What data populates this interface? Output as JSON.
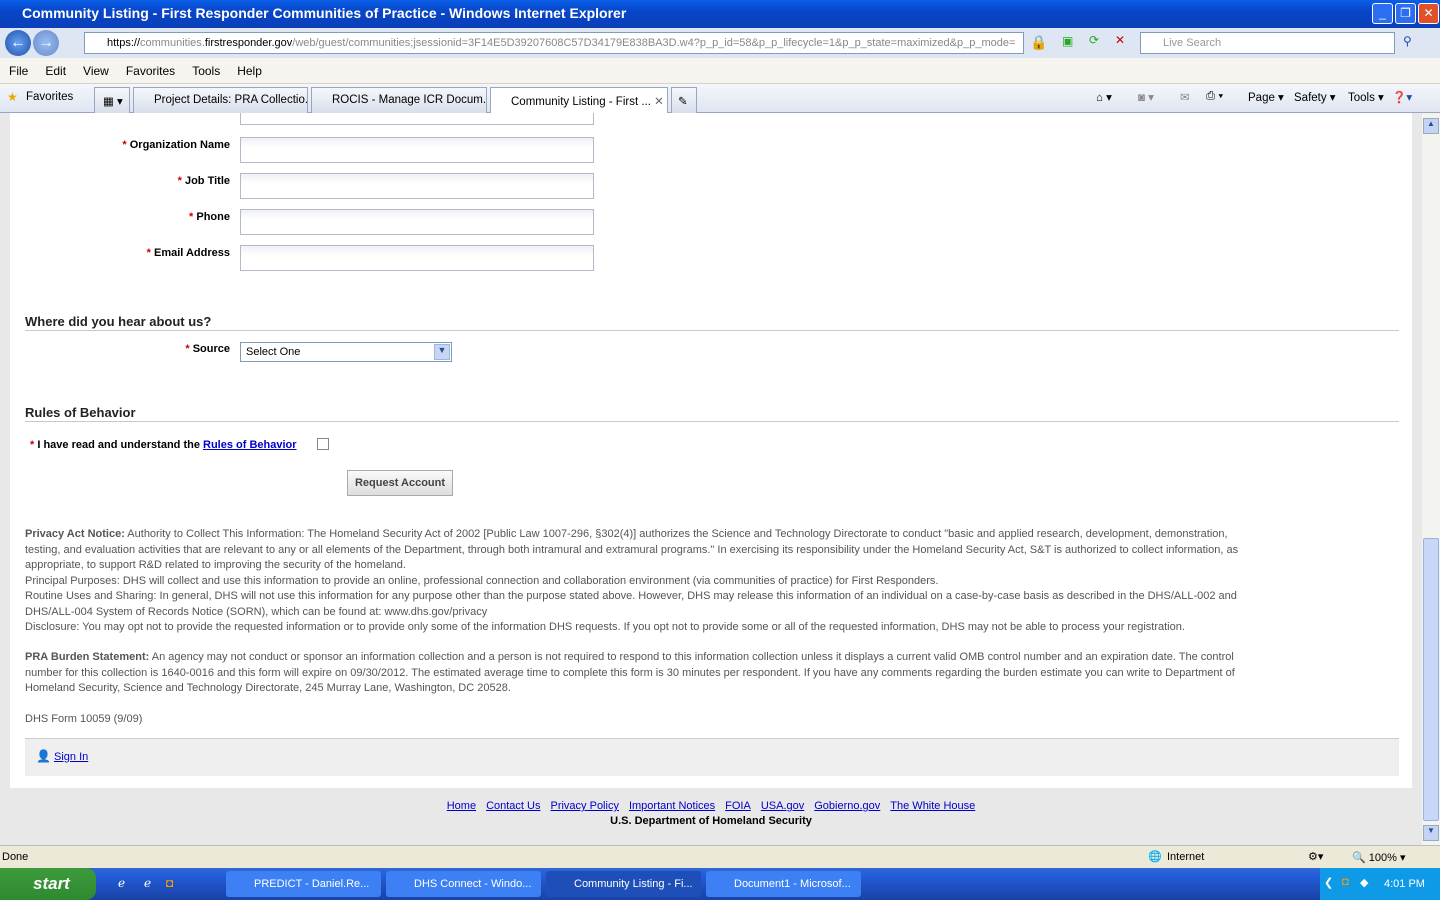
{
  "window": {
    "title": "Community Listing - First Responder Communities of Practice - Windows Internet Explorer"
  },
  "address": {
    "scheme": "https://",
    "host_pre": "communities.",
    "host": "firstresponder.gov",
    "path": "/web/guest/communities;jsessionid=3F14E5D39207608C57D34179E838BA3D.w4?p_p_id=58&p_p_lifecycle=1&p_p_state=maximized&p_p_mode=",
    "search_placeholder": "Live Search"
  },
  "menu": [
    "File",
    "Edit",
    "View",
    "Favorites",
    "Tools",
    "Help"
  ],
  "favorites_label": "Favorites",
  "tabs": [
    {
      "label": "Project Details: PRA Collectio..."
    },
    {
      "label": "ROCIS - Manage ICR Docum..."
    },
    {
      "label": "Community Listing - First ..."
    }
  ],
  "toolbar": {
    "page": "Page",
    "safety": "Safety",
    "tools": "Tools"
  },
  "form": {
    "fields": [
      {
        "label": "Organization Name",
        "value": ""
      },
      {
        "label": "Job Title",
        "value": ""
      },
      {
        "label": "Phone",
        "value": ""
      },
      {
        "label": "Email Address",
        "value": ""
      }
    ],
    "required_marker": "*",
    "hear_heading": "Where did you hear about us?",
    "source_label": "Source",
    "source_value": "Select One",
    "rules_heading": "Rules of Behavior",
    "rules_text": "I have read and understand the ",
    "rules_link": "Rules of Behavior",
    "rules_checked": false,
    "submit": "Request Account"
  },
  "notice": {
    "privacy_title": "Privacy Act Notice:",
    "privacy_text": " Authority to Collect This Information: The Homeland Security Act of 2002 [Public Law 1007-296, §302(4)] authorizes the Science and Technology Directorate to conduct \"basic and applied research, development, demonstration, testing, and evaluation activities that are relevant to any or all elements of the Department, through both intramural and extramural programs.\" In exercising its responsibility under the Homeland Security Act, S&T is authorized to collect information, as appropriate, to support R&D related to improving the security of the homeland.",
    "principal": "Principal Purposes: DHS will collect and use this information to provide an online, professional connection and collaboration environment (via communities of practice) for First Responders.",
    "routine": "Routine Uses and Sharing: In general, DHS will not use this information for any purpose other than the purpose stated above. However, DHS may release this information of an individual on a case-by-case basis as described in the DHS/ALL-002 and DHS/ALL-004 System of Records Notice (SORN), which can be found at: www.dhs.gov/privacy",
    "disclosure": "Disclosure: You may opt not to provide the requested information or to provide only some of the information DHS requests. If you opt not to provide some or all of the requested information, DHS may not be able to process your registration.",
    "pra_title": "PRA Burden Statement:",
    "pra_text": " An agency may not conduct or sponsor an information collection and a person is not required to respond to this information collection unless it displays a current valid OMB control number and an expiration date. The control number for this collection is 1640-0016 and this form will expire on 09/30/2012. The estimated average time to complete this form is 30 minutes per respondent. If you have any comments regarding the burden estimate you can write to Department of Homeland Security, Science and Technology Directorate, 245 Murray Lane, Washington, DC 20528.",
    "form_id": "DHS Form 10059 (9/09)"
  },
  "sign_in": "Sign In",
  "footer": {
    "links": [
      "Home",
      "Contact Us",
      "Privacy Policy",
      "Important Notices",
      "FOIA",
      "USA.gov",
      "Gobierno.gov",
      "The White House"
    ],
    "org": "U.S. Department of Homeland Security"
  },
  "status": {
    "text": "Done",
    "zone": "Internet",
    "zoom": "100%"
  },
  "taskbar": {
    "start": "start",
    "tasks": [
      "PREDICT - Daniel.Re...",
      "DHS Connect - Windo...",
      "Community Listing - Fi...",
      "Document1 - Microsof..."
    ],
    "clock": "4:01 PM"
  }
}
